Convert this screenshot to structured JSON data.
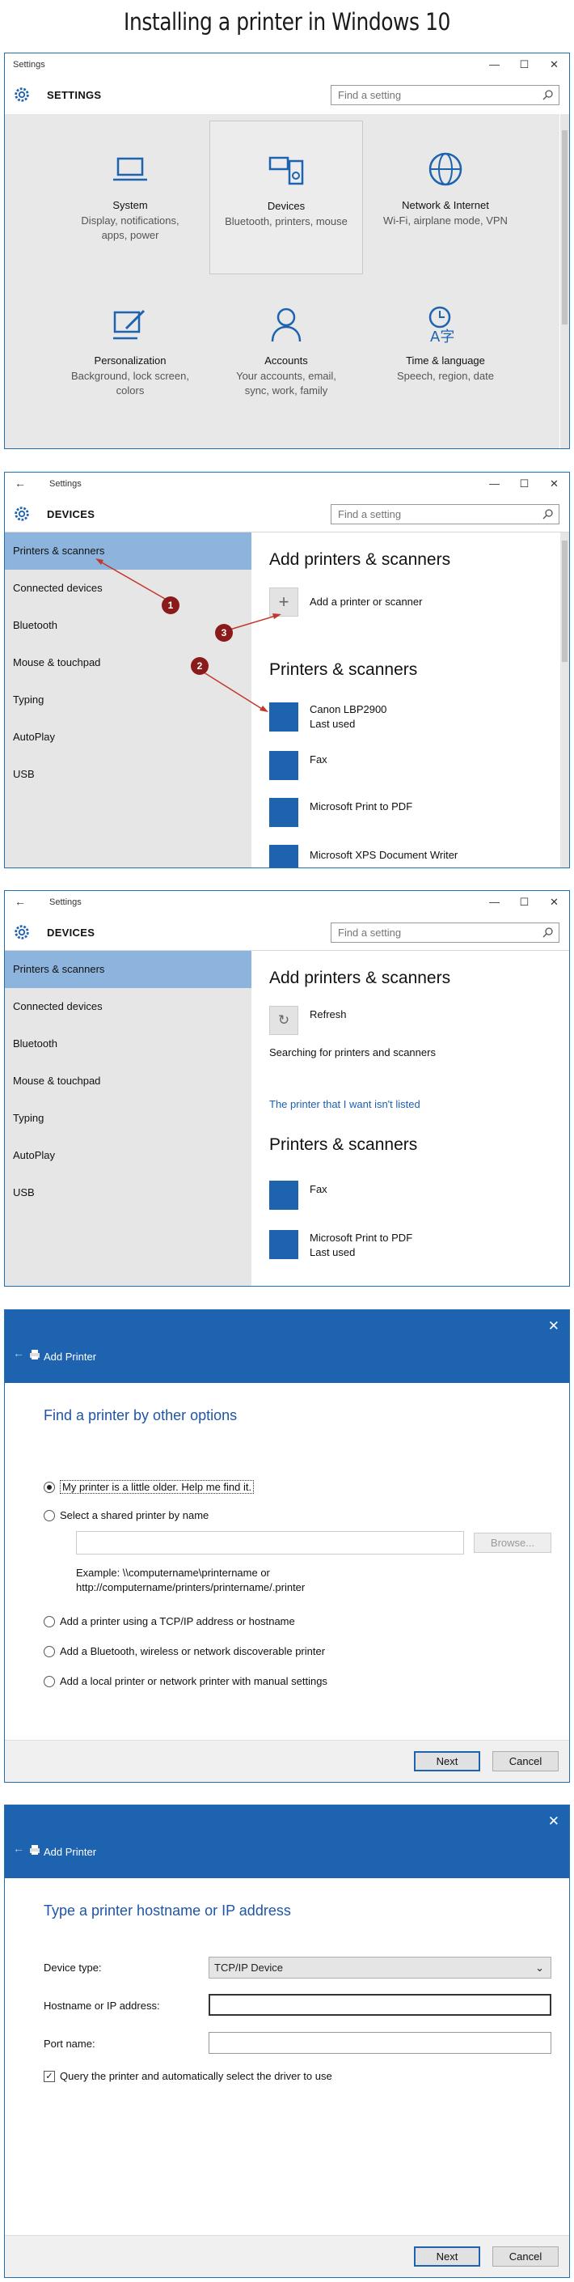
{
  "heading": "Installing a printer in Windows 10",
  "home": {
    "window_title": "Settings",
    "header": "SETTINGS",
    "search_placeholder": "Find a setting",
    "tiles": [
      {
        "name": "System",
        "desc": "Display, notifications, apps, power"
      },
      {
        "name": "Devices",
        "desc": "Bluetooth, printers, mouse"
      },
      {
        "name": "Network & Internet",
        "desc": "Wi-Fi, airplane mode, VPN"
      },
      {
        "name": "Personalization",
        "desc": "Background, lock screen, colors"
      },
      {
        "name": "Accounts",
        "desc": "Your accounts, email, sync, work, family"
      },
      {
        "name": "Time & language",
        "desc": "Speech, region, date"
      }
    ]
  },
  "devices": {
    "window_title": "Settings",
    "header": "DEVICES",
    "search_placeholder": "Find a setting",
    "nav": [
      "Printers & scanners",
      "Connected devices",
      "Bluetooth",
      "Mouse & touchpad",
      "Typing",
      "AutoPlay",
      "USB"
    ],
    "add_title": "Add printers & scanners",
    "add_label": "Add a printer or scanner",
    "list_title": "Printers & scanners",
    "printers": [
      {
        "name": "Canon LBP2900",
        "status": "Last used"
      },
      {
        "name": "Fax",
        "status": ""
      },
      {
        "name": "Microsoft Print to PDF",
        "status": ""
      },
      {
        "name": "Microsoft XPS Document Writer",
        "status": ""
      }
    ],
    "badges": [
      "1",
      "2",
      "3"
    ]
  },
  "devices2": {
    "window_title": "Settings",
    "header": "DEVICES",
    "search_placeholder": "Find a setting",
    "nav": [
      "Printers & scanners",
      "Connected devices",
      "Bluetooth",
      "Mouse & touchpad",
      "Typing",
      "AutoPlay",
      "USB"
    ],
    "add_title": "Add printers & scanners",
    "refresh_label": "Refresh",
    "searching": "Searching for printers and scanners",
    "not_listed": "The printer that I want isn't listed",
    "list_title": "Printers & scanners",
    "printers": [
      {
        "name": "Fax",
        "status": ""
      },
      {
        "name": "Microsoft Print to PDF",
        "status": "Last used"
      }
    ]
  },
  "add_printer1": {
    "title": "Add Printer",
    "heading": "Find a printer by other options",
    "options": [
      "My printer is a little older. Help me find it.",
      "Select a shared printer by name",
      "Add a printer using a TCP/IP address or hostname",
      "Add a Bluetooth, wireless or network discoverable printer",
      "Add a local printer or network printer with manual settings"
    ],
    "browse": "Browse...",
    "example": "Example: \\\\computername\\printername or",
    "example2": "http://computername/printers/printername/.printer",
    "next": "Next",
    "cancel": "Cancel"
  },
  "add_printer2": {
    "title": "Add Printer",
    "heading": "Type a printer hostname or IP address",
    "device_type_label": "Device type:",
    "device_type_value": "TCP/IP Device",
    "host_label": "Hostname or IP address:",
    "port_label": "Port name:",
    "query_label": "Query the printer and automatically select the driver to use",
    "next": "Next",
    "cancel": "Cancel"
  }
}
